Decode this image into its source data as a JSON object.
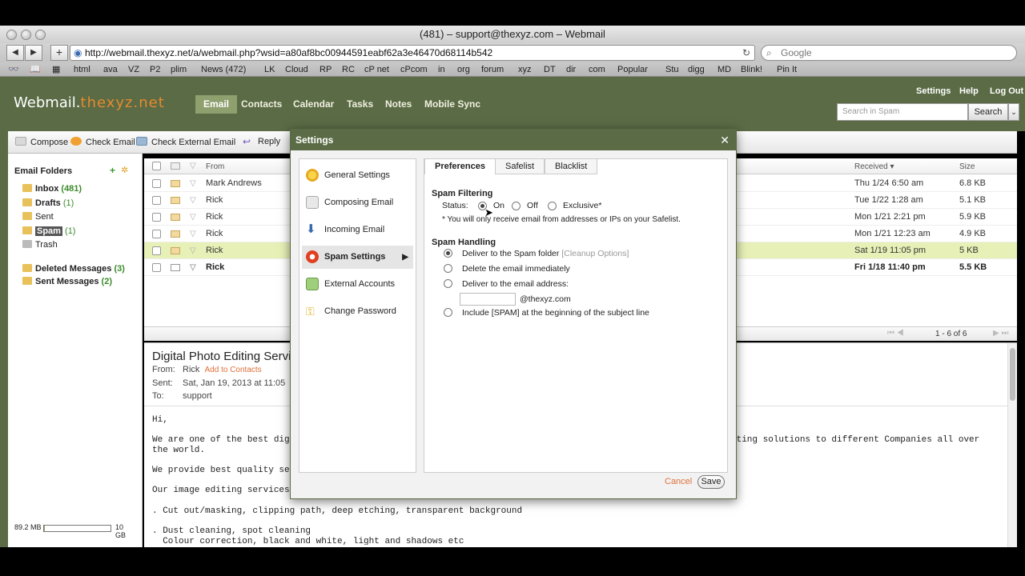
{
  "browser": {
    "window_title": "(481) – support@thexyz.com – Webmail",
    "url": "http://webmail.thexyz.net/a/webmail.php?wsid=a80af8bc00944591eabf62a3e46470d68114b542",
    "search_placeholder": "Google",
    "bookmarks": [
      "html",
      "ava",
      "VZ",
      "P2",
      "plim",
      "News (472)",
      "LK",
      "Cloud",
      "RP",
      "RC",
      "cP net",
      "cPcom",
      "in",
      "org",
      "forum",
      "xyz",
      "DT",
      "dir",
      "com",
      "Popular",
      "Stu",
      "digg",
      "MD",
      "Blink!",
      "Pin It"
    ]
  },
  "app": {
    "logo_prefix": "Webmail.",
    "logo_suffix": "thexyz.net",
    "nav": [
      "Email",
      "Contacts",
      "Calendar",
      "Tasks",
      "Notes",
      "Mobile Sync"
    ],
    "top_links": [
      "Settings",
      "Help",
      "Log Out"
    ],
    "search_placeholder": "Search in Spam",
    "search_button": "Search"
  },
  "actions": [
    "Compose",
    "Check Email",
    "Check External Email",
    "Reply"
  ],
  "sidebar": {
    "header": "Email Folders",
    "folders": [
      {
        "name": "Inbox",
        "count": "(481)"
      },
      {
        "name": "Drafts",
        "count": "(1)"
      },
      {
        "name": "Sent",
        "count": ""
      },
      {
        "name": "Spam",
        "count": "(1)"
      },
      {
        "name": "Trash",
        "count": ""
      },
      {
        "name": "Deleted Messages",
        "count": "(3)"
      },
      {
        "name": "Sent Messages",
        "count": "(2)"
      }
    ],
    "usage_used": "89.2 MB",
    "usage_total": "10 GB",
    "usage_fraction": 0.01
  },
  "message_list": {
    "columns": {
      "from": "From",
      "received": "Received",
      "size": "Size"
    },
    "rows": [
      {
        "from": "Mark Andrews",
        "received": "Thu 1/24 6:50 am",
        "size": "6.8 KB"
      },
      {
        "from": "Rick",
        "received": "Tue 1/22 1:28 am",
        "size": "5.1 KB"
      },
      {
        "from": "Rick",
        "received": "Mon 1/21 2:21 pm",
        "size": "5.9 KB"
      },
      {
        "from": "Rick",
        "received": "Mon 1/21 12:23 am",
        "size": "4.9 KB"
      },
      {
        "from": "Rick",
        "received": "Sat 1/19 11:05 pm",
        "size": "5 KB"
      },
      {
        "from": "Rick",
        "received": "Fri 1/18 11:40 pm",
        "size": "5.5 KB"
      }
    ],
    "pager": "1 - 6 of 6"
  },
  "preview": {
    "subject": "Digital Photo Editing Servi",
    "from_label": "From:",
    "from": "Rick",
    "add_contact": "Add to Contacts",
    "sent_label": "Sent:",
    "sent": "Sat, Jan 19, 2013 at 11:05",
    "to_label": "To:",
    "to": "support",
    "lines": [
      "Hi,",
      "We are one of the best digi",
      "iting solutions to different Companies all over",
      "the world.",
      "We provide best quality ser",
      "Our image editing services",
      ". Cut out/masking, clipping path, deep etching, transparent background",
      ". Dust cleaning, spot cleaning",
      "  Colour correction, black and white, light and shadows etc"
    ]
  },
  "settings_modal": {
    "title": "Settings",
    "menu": [
      "General Settings",
      "Composing Email",
      "Incoming Email",
      "Spam Settings",
      "External Accounts",
      "Change Password"
    ],
    "tabs": [
      "Preferences",
      "Safelist",
      "Blacklist"
    ],
    "spam_filtering": {
      "heading": "Spam Filtering",
      "status_label": "Status:",
      "options": [
        "On",
        "Off",
        "Exclusive*"
      ],
      "note": "* You will only receive email from addresses or IPs on your Safelist."
    },
    "spam_handling": {
      "heading": "Spam Handling",
      "options": [
        "Deliver to the Spam folder",
        "Delete the email immediately",
        "Deliver to the email address:",
        "Include [SPAM] at the beginning of the subject line"
      ],
      "cleanup": "[Cleanup Options]",
      "domain": "@thexyz.com"
    },
    "cancel": "Cancel",
    "save": "Save"
  }
}
